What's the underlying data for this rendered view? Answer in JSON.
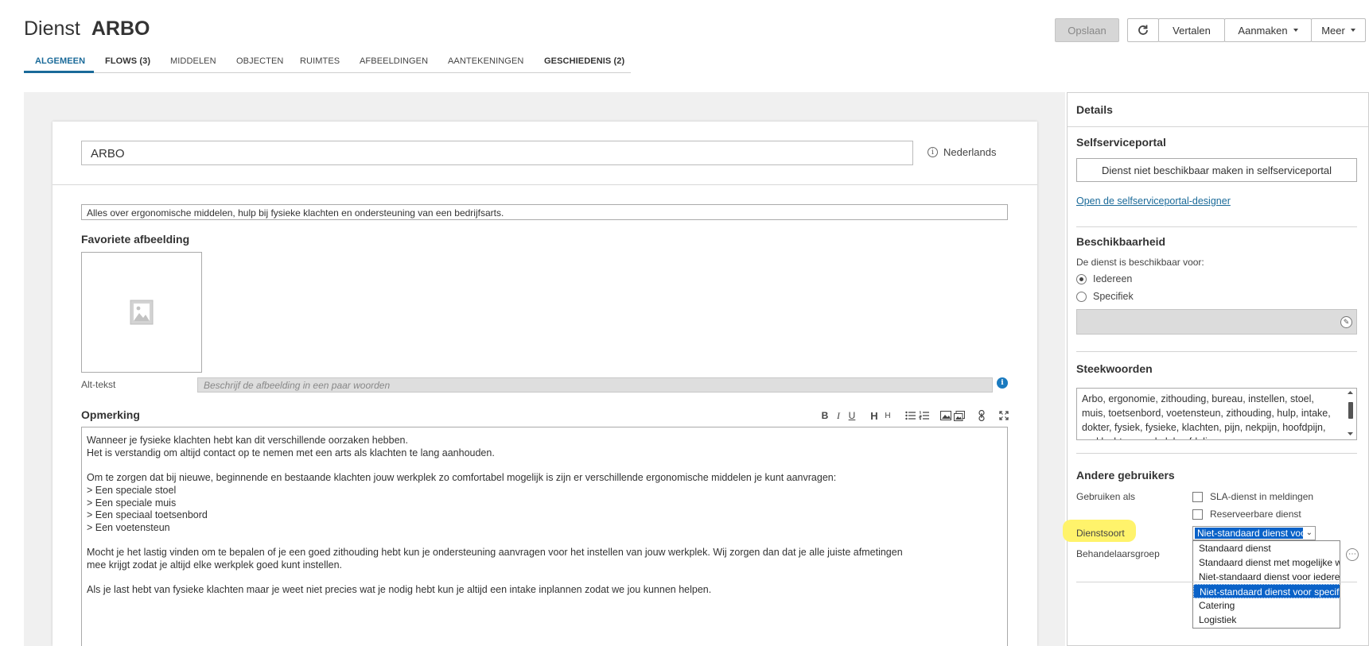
{
  "header": {
    "title_prefix": "Dienst",
    "title_name": "ARBO",
    "save_label": "Opslaan",
    "translate_label": "Vertalen",
    "create_label": "Aanmaken",
    "more_label": "Meer"
  },
  "tabs": [
    {
      "label": "ALGEMEEN"
    },
    {
      "label": "FLOWS (3)"
    },
    {
      "label": "MIDDELEN"
    },
    {
      "label": "OBJECTEN"
    },
    {
      "label": "RUIMTES"
    },
    {
      "label": "AFBEELDINGEN"
    },
    {
      "label": "AANTEKENINGEN"
    },
    {
      "label": "GESCHIEDENIS (2)"
    }
  ],
  "form": {
    "name_value": "ARBO",
    "language": "Nederlands",
    "description": "Alles over ergonomische middelen, hulp bij fysieke klachten en ondersteuning van een bedrijfsarts.",
    "image_label": "Favoriete afbeelding",
    "alt_label": "Alt-tekst",
    "alt_placeholder": "Beschrijf de afbeelding in een paar woorden",
    "remark_label": "Opmerking",
    "remark_paragraphs": [
      "Wanneer je fysieke klachten hebt kan dit verschillende oorzaken hebben.\nHet is verstandig om altijd contact op te nemen met een arts als klachten te lang aanhouden.",
      "Om te zorgen dat bij nieuwe, beginnende en bestaande klachten jouw werkplek zo comfortabel mogelijk is zijn er verschillende ergonomische middelen je kunt aanvragen:\n> Een speciale stoel\n> Een speciale muis\n> Een speciaal toetsenbord\n> Een voetensteun",
      "Mocht je het lastig vinden om te bepalen of je een goed zithouding hebt kun je ondersteuning aanvragen voor het instellen van jouw werkplek. Wij zorgen dan dat je alle juiste afmetingen\nmee krijgt zodat je altijd elke werkplek goed kunt instellen.",
      "Als je last hebt van fysieke klachten maar je weet niet precies wat je nodig hebt kun je altijd een intake inplannen zodat we jou kunnen helpen."
    ]
  },
  "details": {
    "title": "Details",
    "portal_title": "Selfserviceportal",
    "portal_button": "Dienst niet beschikbaar maken in selfserviceportal",
    "portal_link": "Open de selfserviceportal-designer",
    "availability_title": "Beschikbaarheid",
    "availability_text": "De dienst is beschikbaar voor:",
    "radio_everyone": "Iedereen",
    "radio_specific": "Specifiek",
    "keywords_title": "Steekwoorden",
    "keywords": "Arbo, ergonomie, zithouding, bureau, instellen, stoel, muis, toetsenbord, voetensteun, zithouding, hulp, intake, dokter, fysiek, fysieke, klachten, pijn, nekpijn, hoofdpijn, rugklachten, werkplek, afdeling",
    "other_users_title": "Andere gebruikers",
    "use_as_label": "Gebruiken als",
    "sla_label": "SLA-dienst in meldingen",
    "reservable_label": "Reserveerbare dienst",
    "service_type_label": "Dienstsoort",
    "handler_group_label": "Behandelaarsgroep",
    "service_type_selected": "Niet-standaard dienst voor specifieke gebruikers",
    "service_type_options": [
      "Standaard dienst",
      "Standaard dienst met mogelijke wijzigingen",
      "Niet-standaard dienst voor iedereen",
      "Niet-standaard dienst voor specifieke gebruikers",
      "Catering",
      "Logistiek"
    ]
  },
  "colors": {
    "accent": "#1a6a99",
    "select_highlight": "#0a62c8",
    "marker_highlight": "#fff36b"
  }
}
